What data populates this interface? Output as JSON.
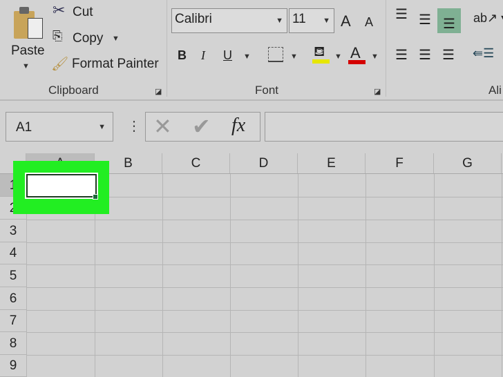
{
  "clipboard": {
    "paste": "Paste",
    "cut": "Cut",
    "copy": "Copy",
    "format_painter": "Format Painter",
    "group_label": "Clipboard"
  },
  "font": {
    "font_name": "Calibri",
    "font_size": "11",
    "bold": "B",
    "italic": "I",
    "underline": "U",
    "group_label": "Font",
    "grow": "A",
    "shrink": "A",
    "font_color_glyph": "A",
    "highlight_color": "#e6e600",
    "font_color": "#d40000"
  },
  "alignment": {
    "group_label": "Ali"
  },
  "formula_bar": {
    "name_box": "A1",
    "fx": "fx",
    "value": ""
  },
  "columns": [
    "A",
    "B",
    "C",
    "D",
    "E",
    "F",
    "G"
  ],
  "rows": [
    "1",
    "2",
    "3",
    "4",
    "5",
    "6",
    "7",
    "8",
    "9"
  ],
  "selected_cell": "A1",
  "highlight": "#22ee22"
}
